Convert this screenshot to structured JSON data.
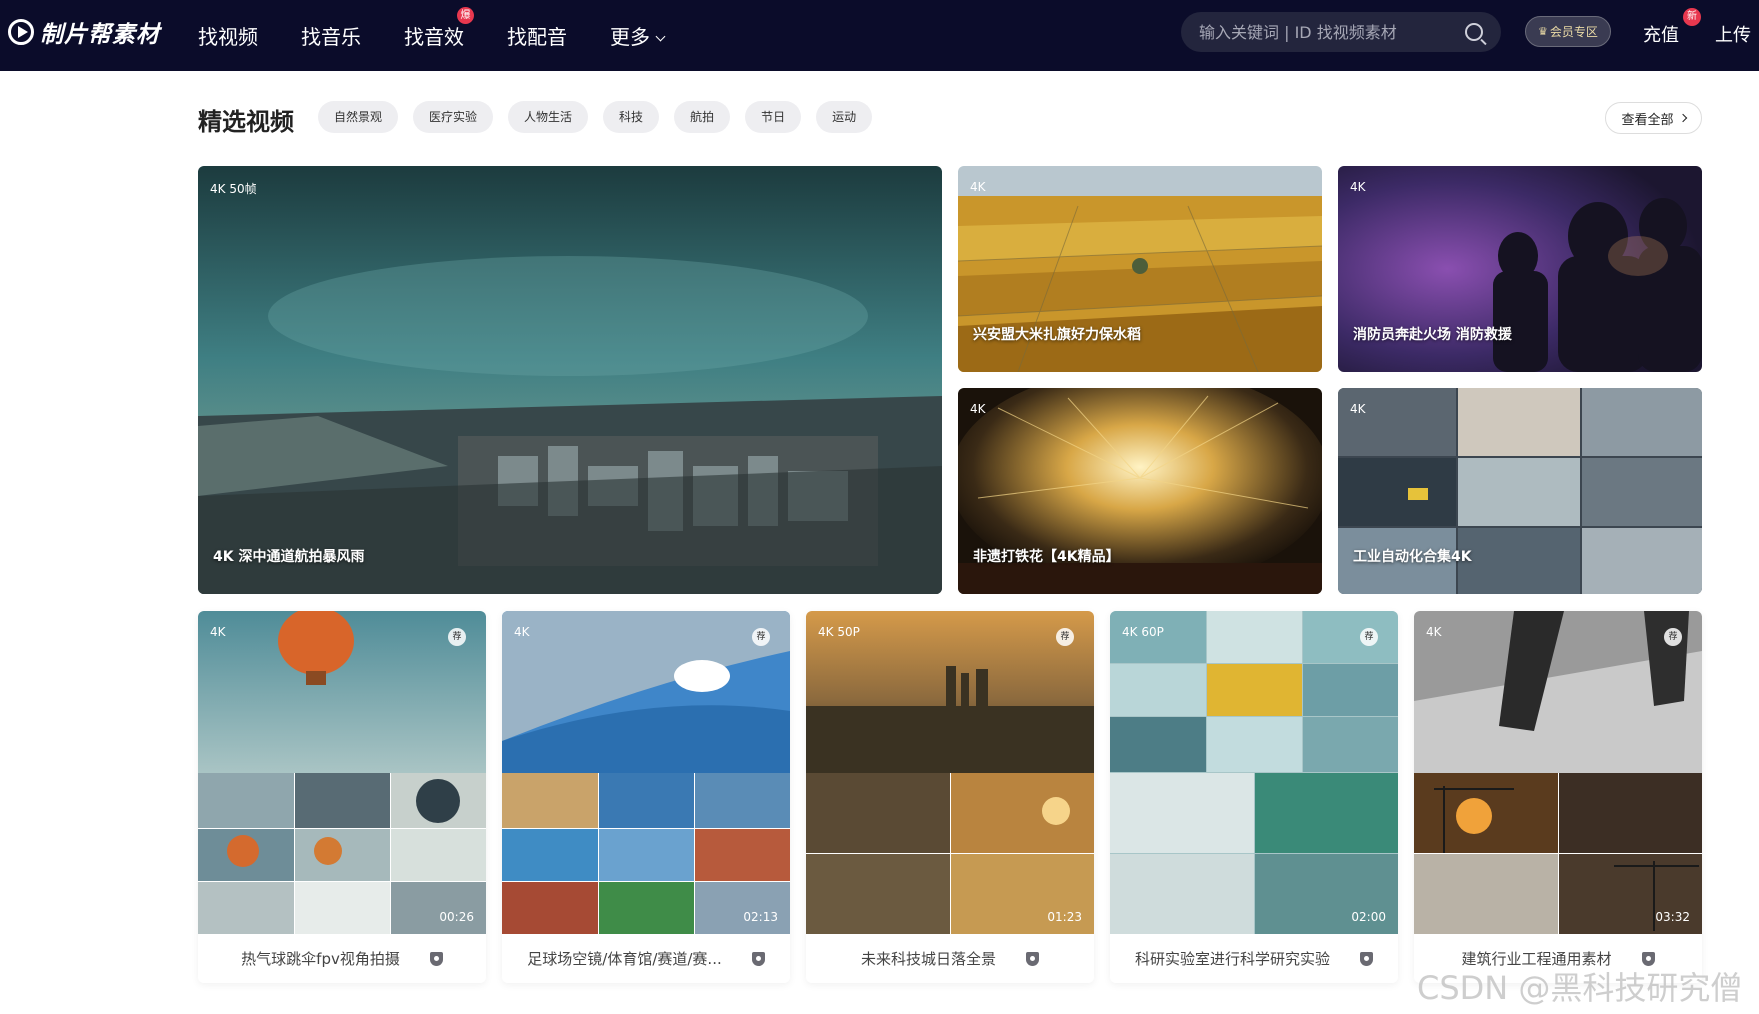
{
  "header": {
    "logo_text": "制片帮素材",
    "nav": [
      {
        "label": "找视频"
      },
      {
        "label": "找音乐"
      },
      {
        "label": "找音效",
        "badge": "爆"
      },
      {
        "label": "找配音"
      },
      {
        "label": "更多"
      }
    ],
    "search_placeholder": "输入关键词 | ID 找视频素材",
    "vip_label": "会员专区",
    "recharge_label": "充值",
    "recharge_badge": "新",
    "upload_label": "上传"
  },
  "section": {
    "title": "精选视频",
    "tags": [
      "自然景观",
      "医疗实验",
      "人物生活",
      "科技",
      "航拍",
      "节日",
      "运动"
    ],
    "view_all": "查看全部"
  },
  "featured": [
    {
      "res": "4K  50帧",
      "title": "4K 深中通道航拍暴风雨"
    },
    {
      "res": "4K",
      "title": "兴安盟大米扎旗好力保水稻"
    },
    {
      "res": "4K",
      "title": "消防员奔赴火场 消防救援"
    },
    {
      "res": "4K",
      "title": "非遗打铁花【4K精品】"
    },
    {
      "res": "4K",
      "title": "工业自动化合集4K"
    }
  ],
  "bottom": [
    {
      "res": "4K",
      "rec": "荐",
      "duration": "00:26",
      "caption": "热气球跳伞fpv视角拍摄"
    },
    {
      "res": "4K",
      "rec": "荐",
      "duration": "02:13",
      "caption": "足球场空镜/体育馆/赛道/赛..."
    },
    {
      "res": "4K  50P",
      "rec": "荐",
      "duration": "01:23",
      "caption": "未来科技城日落全景"
    },
    {
      "res": "4K  60P",
      "rec": "荐",
      "duration": "02:00",
      "caption": "科研实验室进行科学研究实验"
    },
    {
      "res": "4K",
      "rec": "荐",
      "duration": "03:32",
      "caption": "建筑行业工程通用素材"
    }
  ],
  "watermark": "CSDN @黑科技研究僧"
}
